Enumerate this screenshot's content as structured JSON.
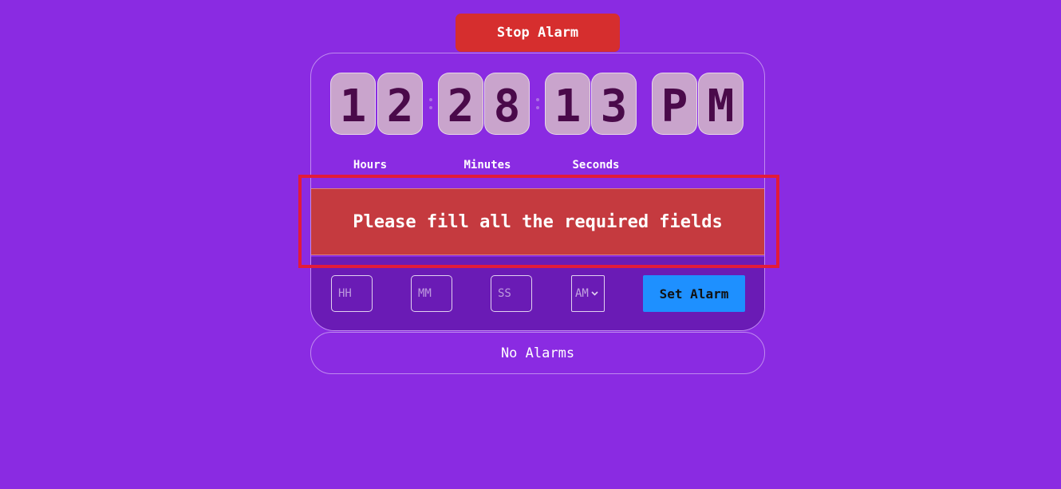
{
  "stop_button": {
    "label": "Stop Alarm"
  },
  "clock": {
    "hours": [
      "1",
      "2"
    ],
    "minutes": [
      "2",
      "8"
    ],
    "seconds": [
      "1",
      "3"
    ],
    "meridiem": [
      "P",
      "M"
    ],
    "labels": {
      "hours": "Hours",
      "minutes": "Minutes",
      "seconds": "Seconds"
    }
  },
  "error": {
    "message": "Please fill all the required fields"
  },
  "form": {
    "hours_placeholder": "HH",
    "minutes_placeholder": "MM",
    "seconds_placeholder": "SS",
    "ampm_value": "AM",
    "set_label": "Set Alarm"
  },
  "alarms": {
    "empty_text": "No Alarms"
  },
  "colors": {
    "background": "#8a2be2",
    "stop": "#d62e2e",
    "error": "#c53a3f",
    "set": "#1e90ff",
    "digit_bg": "#c9a4cc",
    "highlight": "#e21b3a"
  }
}
